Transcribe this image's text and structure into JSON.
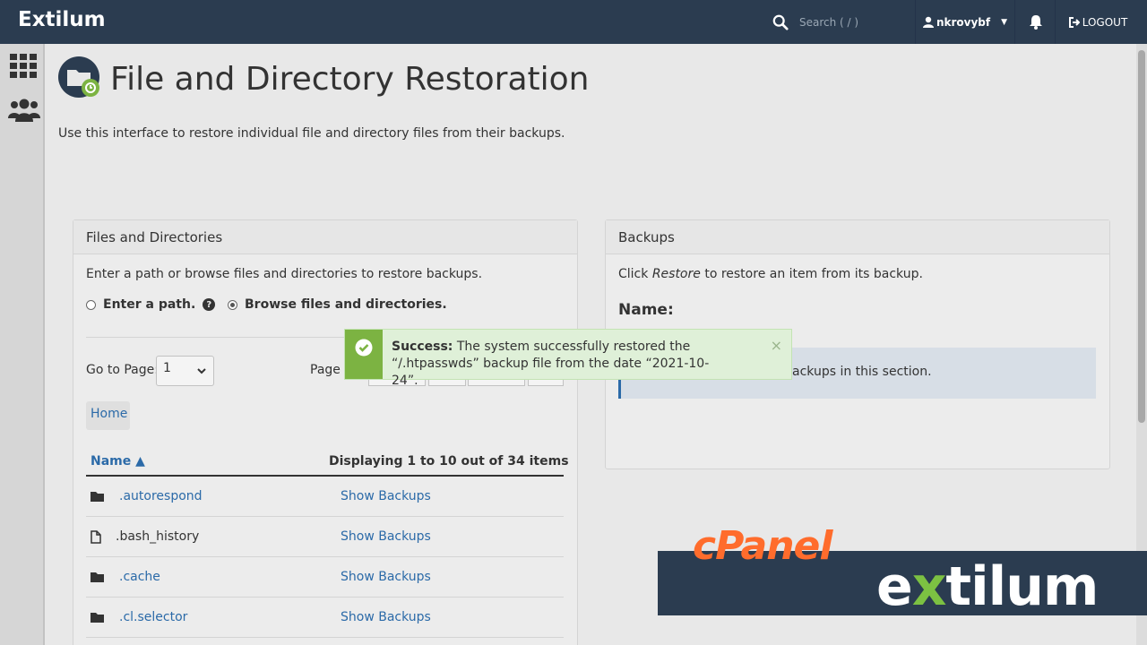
{
  "header": {
    "brand": "Extilum",
    "search_placeholder": "Search ( / )",
    "username": "nkrovybf",
    "logout_label": "LOGOUT"
  },
  "page": {
    "title": "File and Directory Restoration",
    "description": "Use this interface to restore individual file and directory files from their backups."
  },
  "files_panel": {
    "heading": "Files and Directories",
    "instructions": "Enter a path or browse files and directories to restore backups.",
    "radio_path_label": "Enter a path.",
    "radio_browse_label": "Browse files and directories.",
    "selected_mode": "browse",
    "goto_label": "Go to Page:",
    "goto_value": "1",
    "pagesize_label": "Page S",
    "breadcrumb_home": "Home",
    "col_name": "Name ▲",
    "displaying": "Displaying 1 to 10 out of 34 items",
    "rows": [
      {
        "name": ".autorespond",
        "type": "folder",
        "action": "Show Backups"
      },
      {
        "name": ".bash_history",
        "type": "file",
        "action": "Show Backups"
      },
      {
        "name": ".cache",
        "type": "folder",
        "action": "Show Backups"
      },
      {
        "name": ".cl.selector",
        "type": "folder",
        "action": "Show Backups"
      }
    ]
  },
  "backups_panel": {
    "heading": "Backups",
    "instr_prefix": "Click ",
    "instr_em": "Restore",
    "instr_suffix": " to restore an item from its backup.",
    "name_label": "Name:",
    "info_text": "ackups in this section."
  },
  "toast": {
    "label": "Success:",
    "message": " The system successfully restored the “/.htpasswds” backup file from the date “2021-10-24”.",
    "close": "×"
  },
  "promo": {
    "cpanel": "cPanel",
    "brand_pre": "e",
    "brand_x": "x",
    "brand_post": "tilum"
  },
  "colors": {
    "header": "#2b3c50",
    "link": "#2b6aa8",
    "success": "#7cb342",
    "cpanel_orange": "#ff6c2c"
  }
}
